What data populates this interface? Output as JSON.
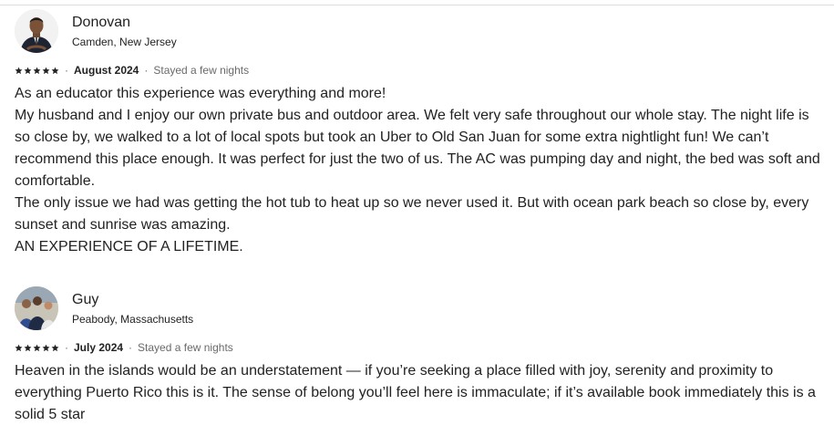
{
  "reviews": [
    {
      "name": "Donovan",
      "location": "Camden, New Jersey",
      "rating": 5,
      "date": "August 2024",
      "separator": "·",
      "stay": "Stayed a few nights",
      "lines": [
        "As an educator this experience was everything and more!",
        "My husband and I enjoy our own private bus and outdoor area. We felt very safe throughout our whole stay. The night life is so close by, we walked to a lot of local spots but took an Uber to Old San Juan for some extra nightlight fun! We can’t recommend this place enough. It was perfect for just the two of us. The AC was pumping day and night, the bed was soft and comfortable.",
        "The only issue we had was getting the hot tub to heat up so we never used it. But with ocean park beach so close by, every sunset and sunrise was amazing.",
        "AN EXPERIENCE OF A LIFETIME."
      ]
    },
    {
      "name": "Guy",
      "location": "Peabody, Massachusetts",
      "rating": 5,
      "date": "July 2024",
      "separator": "·",
      "stay": "Stayed a few nights",
      "lines": [
        "Heaven in the islands would be an understatement — if you’re seeking a place filled with joy, serenity and proximity to everything Puerto Rico this is it. The sense of belong you’ll feel here is immaculate; if it’s available book immediately this is a solid 5 star"
      ]
    }
  ]
}
